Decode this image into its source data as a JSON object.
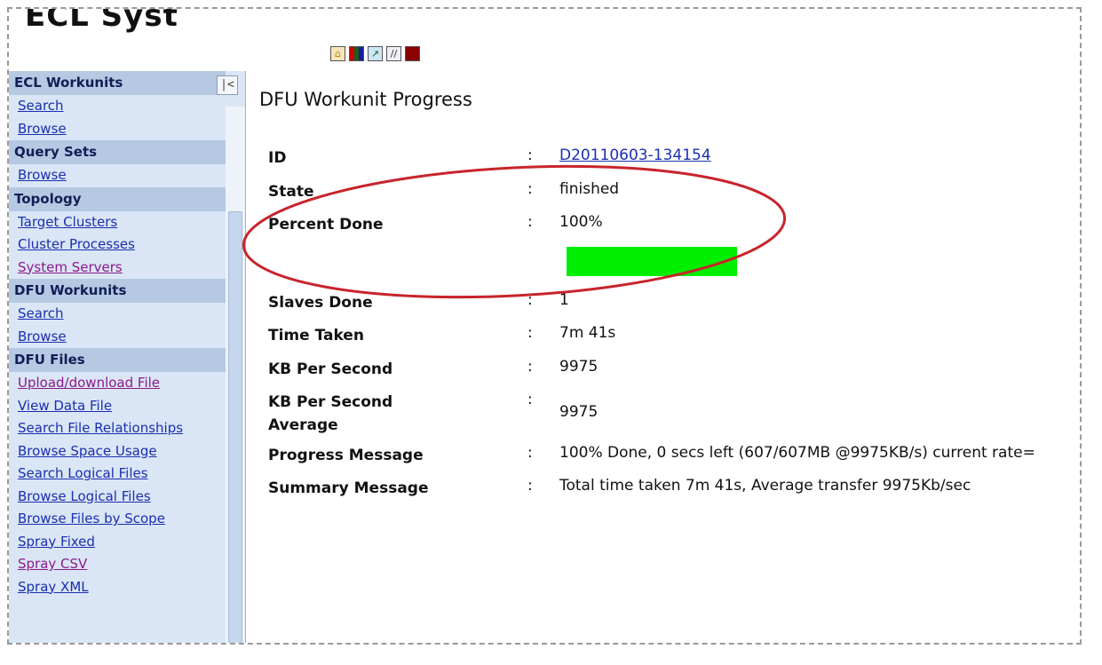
{
  "brand": {
    "text": "ECL Syst"
  },
  "toolbar": {
    "icons": [
      "home-icon",
      "grid-icon",
      "chart-icon",
      "pencil-icon",
      "stop-icon"
    ]
  },
  "sidebar": {
    "collapse_label": "|<",
    "sections": [
      {
        "header": "ECL Workunits",
        "links": [
          "Search",
          "Browse"
        ]
      },
      {
        "header": "Query Sets",
        "links": [
          "Browse"
        ]
      },
      {
        "header": "Topology",
        "links": [
          "Target Clusters",
          "Cluster Processes",
          "System Servers"
        ]
      },
      {
        "header": "DFU Workunits",
        "links": [
          "Search",
          "Browse"
        ]
      },
      {
        "header": "DFU Files",
        "links": [
          "Upload/download File",
          "View Data File",
          "Search File Relationships",
          "Browse Space Usage",
          "Search Logical Files",
          "Browse Logical Files",
          "Browse Files by Scope",
          "Spray Fixed",
          "Spray CSV",
          "Spray XML"
        ]
      }
    ]
  },
  "main": {
    "title": "DFU Workunit Progress",
    "separator": ":",
    "id": {
      "label": "ID",
      "value": "D20110603-134154"
    },
    "state": {
      "label": "State",
      "value": "finished"
    },
    "percent_done": {
      "label": "Percent Done",
      "value": "100%",
      "fraction": 1.0
    },
    "slaves_done": {
      "label": "Slaves Done",
      "value": "1"
    },
    "time_taken": {
      "label": "Time Taken",
      "value": "7m 41s"
    },
    "kb_per_second": {
      "label": "KB Per Second",
      "value": "9975"
    },
    "kb_per_second_avg": {
      "label": "KB Per Second Average",
      "value": "9975"
    },
    "progress_message": {
      "label": "Progress Message",
      "value": "100% Done, 0 secs left (607/607MB @9975KB/s) current rate="
    },
    "summary_message": {
      "label": "Summary Message",
      "value": "Total time taken 7m 41s, Average transfer 9975Kb/sec"
    }
  },
  "colors": {
    "sidebar_bg": "#dae6f5",
    "section_header_bg": "#b6c9e3",
    "link": "#1a2fb0",
    "visited_link": "#8b1a8b",
    "progress_fill": "#00ee00",
    "highlight_ellipse": "#c8242b"
  }
}
